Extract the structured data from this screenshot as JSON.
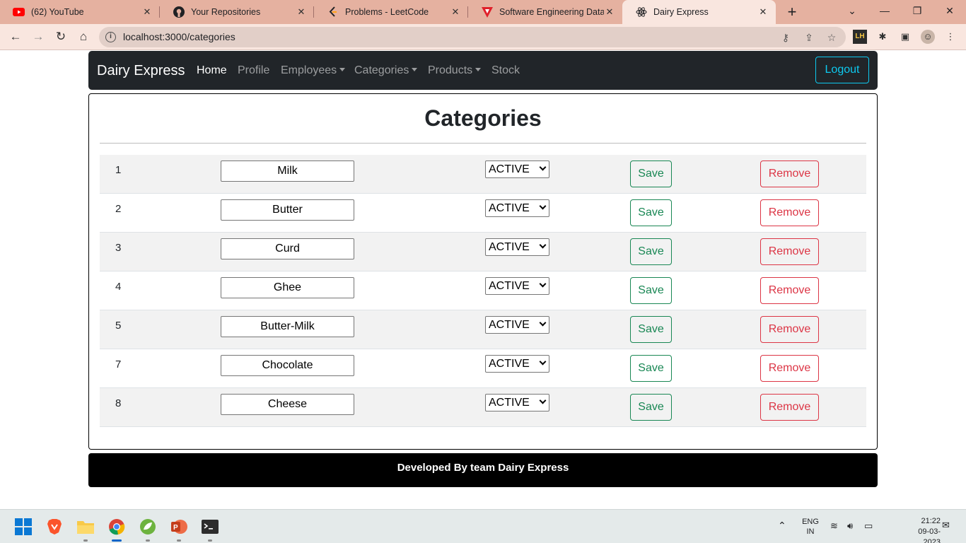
{
  "browser": {
    "tabs": [
      {
        "title": "(62) YouTube",
        "icon": "youtube-icon"
      },
      {
        "title": "Your Repositories",
        "icon": "github-icon"
      },
      {
        "title": "Problems - LeetCode",
        "icon": "leetcode-icon"
      },
      {
        "title": "Software Engineering Data Fl",
        "icon": "vercel-icon"
      },
      {
        "title": "Dairy Express",
        "icon": "react-icon"
      }
    ],
    "url": "localhost:3000/categories"
  },
  "app": {
    "brand": "Dairy Express",
    "nav": {
      "home": "Home",
      "profile": "Profile",
      "employees": "Employees",
      "categories": "Categories",
      "products": "Products",
      "stock": "Stock"
    },
    "logout": "Logout"
  },
  "page": {
    "title": "Categories",
    "rows": [
      {
        "id": "1",
        "name": "Milk",
        "status": "ACTIVE"
      },
      {
        "id": "2",
        "name": "Butter",
        "status": "ACTIVE"
      },
      {
        "id": "3",
        "name": "Curd",
        "status": "ACTIVE"
      },
      {
        "id": "4",
        "name": "Ghee",
        "status": "ACTIVE"
      },
      {
        "id": "5",
        "name": "Butter-Milk",
        "status": "ACTIVE"
      },
      {
        "id": "7",
        "name": "Chocolate",
        "status": "ACTIVE"
      },
      {
        "id": "8",
        "name": "Cheese",
        "status": "ACTIVE"
      }
    ],
    "save_label": "Save",
    "remove_label": "Remove"
  },
  "footer": {
    "text": "Developed By team Dairy Express"
  },
  "taskbar": {
    "language": "ENG",
    "region": "IN",
    "time": "21:22",
    "date": "09-03-2023"
  },
  "colors": {
    "navbar": "#212529",
    "logout_accent": "#0dcaf0",
    "save_accent": "#198754",
    "remove_accent": "#dc3545",
    "footer": "#000000"
  }
}
